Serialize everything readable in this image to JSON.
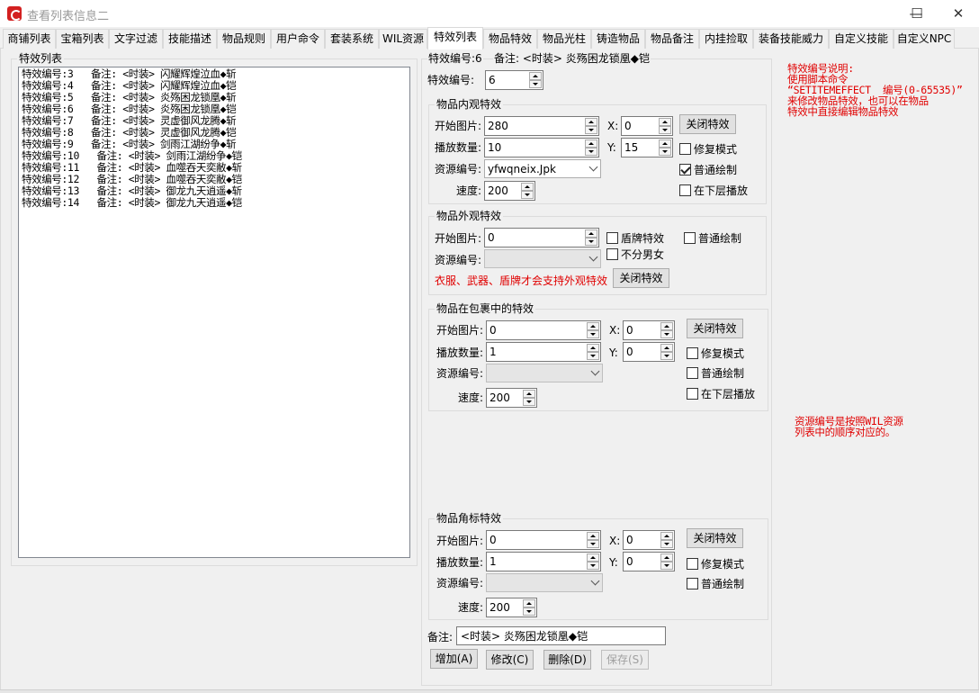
{
  "window": {
    "title": "查看列表信息二",
    "minimize": "—",
    "maximize": "☐",
    "close": "✕"
  },
  "tabs": [
    {
      "label": "商铺列表"
    },
    {
      "label": "宝箱列表"
    },
    {
      "label": "文字过滤"
    },
    {
      "label": "技能描述"
    },
    {
      "label": "物品规则"
    },
    {
      "label": "用户命令"
    },
    {
      "label": "套装系统"
    },
    {
      "label": "WIL资源"
    },
    {
      "label": "特效列表",
      "active": true
    },
    {
      "label": "物品特效"
    },
    {
      "label": "物品光柱"
    },
    {
      "label": "铸造物品"
    },
    {
      "label": "物品备注"
    },
    {
      "label": "内挂捡取"
    },
    {
      "label": "装备技能威力"
    },
    {
      "label": "自定义技能"
    },
    {
      "label": "自定义NPC"
    }
  ],
  "effect_list": {
    "title": "特效列表",
    "items": [
      "特效编号:3   备注: <时装> 闪耀辉煌泣血◆斩",
      "特效编号:4   备注: <时装> 闪耀辉煌泣血◆铠",
      "特效编号:5   备注: <时装> 炎殇困龙锁凰◆斩",
      "特效编号:6   备注: <时装> 炎殇困龙锁凰◆铠",
      "特效编号:7   备注: <时装> 灵虚御风龙腾◆斩",
      "特效编号:8   备注: <时装> 灵虚御风龙腾◆铠",
      "特效编号:9   备注: <时装> 剑雨江湖纷争◆斩",
      "特效编号:10   备注: <时装> 剑雨江湖纷争◆铠",
      "特效编号:11   备注: <时装> 血噬吞天奕敝◆斩",
      "特效编号:12   备注: <时装> 血噬吞天奕敝◆铠",
      "特效编号:13   备注: <时装> 御龙九天逍遥◆斩",
      "特效编号:14   备注: <时装> 御龙九天逍遥◆铠"
    ]
  },
  "header": {
    "current_id_text": "特效编号:6",
    "current_note_text": "备注: <时装> 炎殇困龙锁凰◆铠",
    "id_label": "特效编号:",
    "id_value": "6"
  },
  "inner_effect": {
    "title": "物品内观特效",
    "start_label": "开始图片:",
    "start_value": "280",
    "count_label": "播放数量:",
    "count_value": "10",
    "res_label": "资源编号:",
    "res_value": "yfwqneix.Jpk",
    "speed_label": "速度:",
    "speed_value": "200",
    "x_label": "X:",
    "x_value": "0",
    "y_label": "Y:",
    "y_value": "15",
    "close_btn": "关闭特效",
    "fix_mode": "修复模式",
    "fix_mode_checked": false,
    "normal_draw": "普通绘制",
    "normal_draw_checked": true,
    "lower_layer": "在下层播放",
    "lower_layer_checked": false
  },
  "outer_effect": {
    "title": "物品外观特效",
    "start_label": "开始图片:",
    "start_value": "0",
    "res_label": "资源编号:",
    "res_value": "",
    "shield_effect": "盾牌特效",
    "shield_checked": false,
    "normal_draw": "普通绘制",
    "normal_draw_checked": false,
    "no_gender": "不分男女",
    "no_gender_checked": false,
    "warning": "衣服、武器、盾牌才会支持外观特效",
    "close_btn": "关闭特效"
  },
  "bag_effect": {
    "title": "物品在包裹中的特效",
    "start_label": "开始图片:",
    "start_value": "0",
    "count_label": "播放数量:",
    "count_value": "1",
    "res_label": "资源编号:",
    "res_value": "",
    "speed_label": "速度:",
    "speed_value": "200",
    "x_label": "X:",
    "x_value": "0",
    "y_label": "Y:",
    "y_value": "0",
    "close_btn": "关闭特效",
    "fix_mode": "修复模式",
    "normal_draw": "普通绘制",
    "lower_layer": "在下层播放"
  },
  "corner_effect": {
    "title": "物品角标特效",
    "start_label": "开始图片:",
    "start_value": "0",
    "count_label": "播放数量:",
    "count_value": "1",
    "res_label": "资源编号:",
    "res_value": "",
    "speed_label": "速度:",
    "speed_value": "200",
    "x_label": "X:",
    "x_value": "0",
    "y_label": "Y:",
    "y_value": "0",
    "close_btn": "关闭特效",
    "fix_mode": "修复模式",
    "normal_draw": "普通绘制"
  },
  "note": {
    "label": "备注:",
    "value": "<时装> 炎殇困龙锁凰◆铠"
  },
  "actions": {
    "add": "增加(A)",
    "modify": "修改(C)",
    "delete": "删除(D)",
    "save": "保存(S)"
  },
  "help": {
    "effect_id_note": "特效编号说明:\n使用脚本命令\n“SETITEMEFFECT  编号(0-65535)”\n来修改物品特效，也可以在物品\n特效中直接编辑物品特效",
    "res_id_note": "资源编号是按照WIL资源\n列表中的顺序对应的。"
  },
  "colors": {
    "note_red": "#e00000",
    "window_bg": "#f0f0f0"
  }
}
